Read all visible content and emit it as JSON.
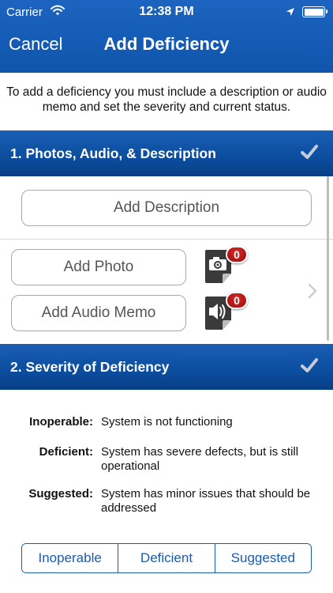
{
  "status_bar": {
    "carrier": "Carrier",
    "time": "12:38 PM"
  },
  "nav": {
    "cancel_label": "Cancel",
    "title": "Add Deficiency"
  },
  "intro_text": "To add a deficiency you must include a description or audio memo and set the severity and current status.",
  "section1": {
    "title": "1. Photos, Audio, & Description",
    "add_description_label": "Add Description",
    "add_photo_label": "Add Photo",
    "add_audio_label": "Add Audio Memo",
    "photo_count": "0",
    "audio_count": "0"
  },
  "section2": {
    "title": "2. Severity of Deficiency",
    "levels": [
      {
        "term": "Inoperable:",
        "definition": "System is not functioning"
      },
      {
        "term": "Deficient:",
        "definition": "System has severe defects, but is still operational"
      },
      {
        "term": "Suggested:",
        "definition": "System has minor issues that should be addressed"
      }
    ],
    "options": [
      "Inoperable",
      "Deficient",
      "Suggested"
    ]
  },
  "colors": {
    "nav_blue": "#1560bd",
    "section_blue": "#0b4d9e",
    "badge_red": "#b01818",
    "check_gray": "#bcc6d6"
  },
  "icons": {
    "wifi": "wifi-icon",
    "location": "location-arrow-icon",
    "battery": "battery-icon",
    "check": "checkmark-icon",
    "camera": "camera-document-icon",
    "audio": "speaker-document-icon",
    "chevron": "chevron-right-icon"
  }
}
